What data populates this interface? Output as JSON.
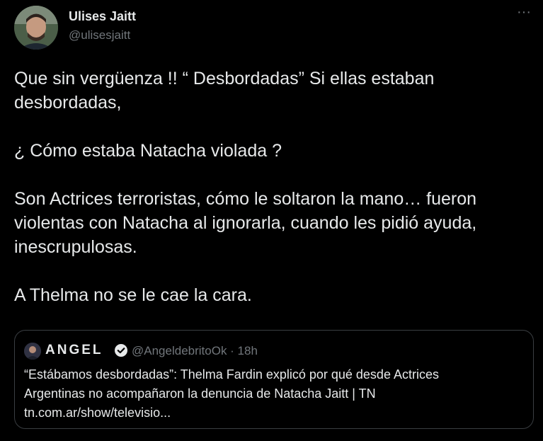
{
  "tweet": {
    "author": {
      "display_name": "Ulises Jaitt",
      "handle": "@ulisesjaitt"
    },
    "more_label": "···",
    "body_lines": [
      "Que sin vergüenza !! “ Desbordadas”  Si ellas estaban desbordadas,",
      "¿ Cómo estaba Natacha violada ?",
      "Son Actrices terroristas, cómo le soltaron la mano… fueron violentas con Natacha al ignorarla, cuando les pidió ayuda, inescrupulosas.",
      "A Thelma no se le cae la cara."
    ]
  },
  "quoted_tweet": {
    "author_name": "ANGEL",
    "handle_time": "@AngeldebritoOk · 18h",
    "verified_icon": "verified-badge-icon",
    "text_lines": [
      "“Estábamos desbordadas”: Thelma Fardin explicó por qué desde Actrices",
      "Argentinas no acompañaron la denuncia de Natacha Jaitt | TN",
      "tn.com.ar/show/televisio..."
    ]
  },
  "colors": {
    "background": "#000000",
    "text": "#e7e9ea",
    "secondary_text": "#71767b",
    "border": "#3a3e42"
  }
}
